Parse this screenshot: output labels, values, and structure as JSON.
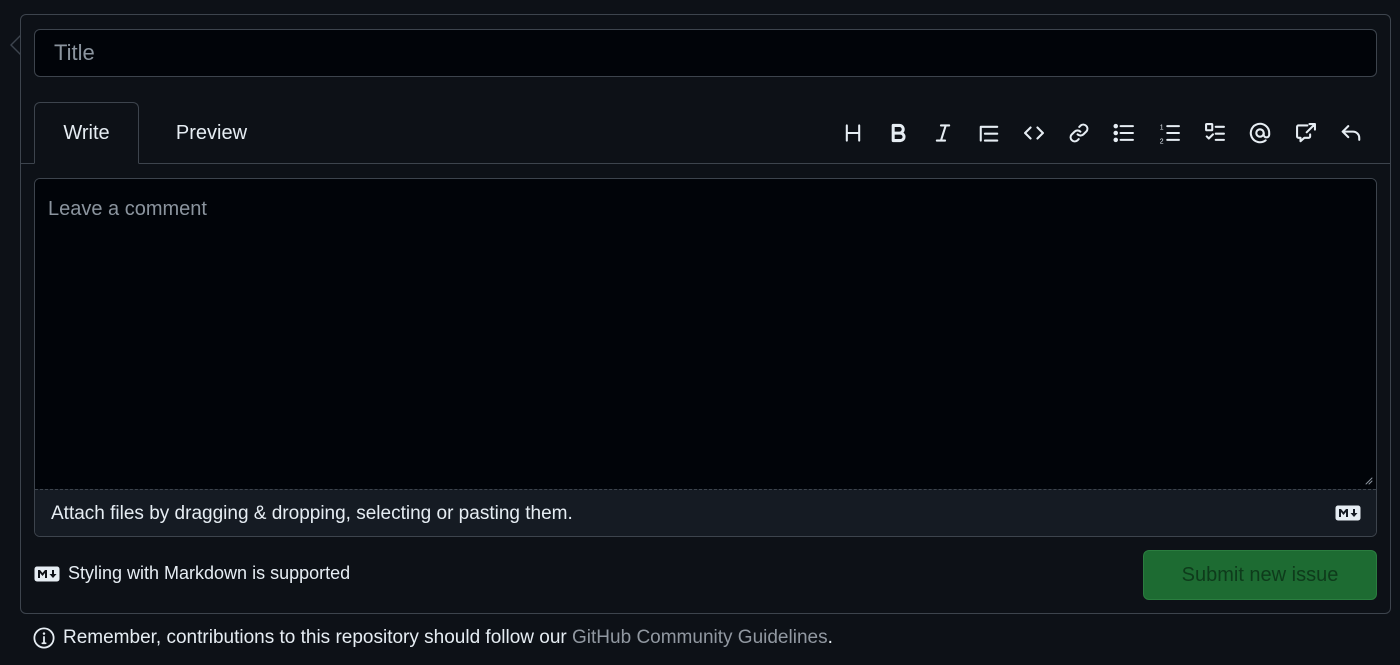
{
  "title_input": {
    "placeholder": "Title",
    "value": ""
  },
  "tabs": [
    {
      "label": "Write",
      "active": true
    },
    {
      "label": "Preview",
      "active": false
    }
  ],
  "toolbar": {
    "icons": [
      "heading-icon",
      "bold-icon",
      "italic-icon",
      "quote-icon",
      "code-icon",
      "link-icon",
      "unordered-list-icon",
      "ordered-list-icon",
      "task-list-icon",
      "mention-icon",
      "cross-reference-icon",
      "reply-icon"
    ]
  },
  "comment": {
    "placeholder": "Leave a comment",
    "value": ""
  },
  "attach": {
    "text": "Attach files by dragging & dropping, selecting or pasting them."
  },
  "markdown_note": {
    "text": "Styling with Markdown is supported"
  },
  "submit": {
    "label": "Submit new issue",
    "disabled": true
  },
  "guidelines": {
    "prefix": "Remember, contributions to this repository should follow our ",
    "link": "GitHub Community Guidelines",
    "suffix": "."
  },
  "colors": {
    "background": "#0d1117",
    "input_background": "#010409",
    "border": "#3d444d",
    "submit_bg": "#1d6b32",
    "link": "#9198a1"
  }
}
